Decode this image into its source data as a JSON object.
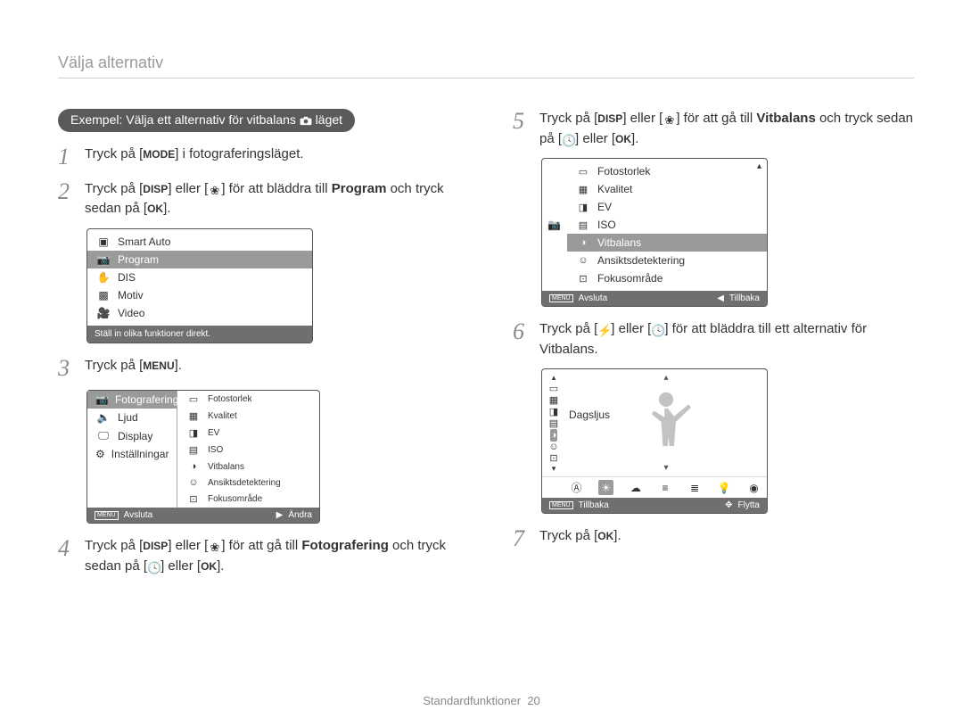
{
  "header": {
    "title": "Välja alternativ"
  },
  "pill": {
    "label_part1": "Exempel: Välja ett alternativ för vitbalans ",
    "label_part2": " läget"
  },
  "steps": {
    "s1": {
      "num": "1",
      "a": "Tryck på [",
      "b": "] i fotograferingsläget."
    },
    "s2": {
      "num": "2",
      "a": "Tryck på [",
      "b": "] eller [",
      "c": "] för att bläddra till ",
      "d": "Program",
      "e": " och tryck sedan på [",
      "f": "]."
    },
    "s3": {
      "num": "3",
      "a": "Tryck på [",
      "b": "]."
    },
    "s4": {
      "num": "4",
      "a": "Tryck på [",
      "b": "] eller [",
      "c": "] för att gå till ",
      "d": "Fotografering",
      "e": " och tryck sedan på [",
      "f": "] eller [",
      "g": "]."
    },
    "s5": {
      "num": "5",
      "a": "Tryck på [",
      "b": "] eller [",
      "c": "] för att gå till ",
      "d": "Vitbalans",
      "e": " och tryck sedan på [",
      "f": "] eller [",
      "g": "]."
    },
    "s6": {
      "num": "6",
      "a": "Tryck på [",
      "b": "] eller [",
      "c": "] för att bläddra till ett alternativ för Vitbalans."
    },
    "s7": {
      "num": "7",
      "a": "Tryck på [",
      "b": "]."
    }
  },
  "lcd1": {
    "items": [
      {
        "label": "Smart Auto"
      },
      {
        "label": "Program",
        "selected": true
      },
      {
        "label": "DIS"
      },
      {
        "label": "Motiv"
      },
      {
        "label": "Video"
      }
    ],
    "status": "Ställ in olika funktioner direkt."
  },
  "lcd2": {
    "left": [
      {
        "label": "Fotografering",
        "selected": true
      },
      {
        "label": "Ljud"
      },
      {
        "label": "Display"
      },
      {
        "label": "Inställningar"
      }
    ],
    "right": [
      "Fotostorlek",
      "Kvalitet",
      "EV",
      "ISO",
      "Vitbalans",
      "Ansiktsdetektering",
      "Fokusområde"
    ],
    "footer": {
      "exit": "Avsluta",
      "change": "Ändra"
    }
  },
  "lcd3": {
    "items": [
      {
        "label": "Fotostorlek"
      },
      {
        "label": "Kvalitet"
      },
      {
        "label": "EV"
      },
      {
        "label": "ISO"
      },
      {
        "label": "Vitbalans",
        "selected": true
      },
      {
        "label": "Ansiktsdetektering"
      },
      {
        "label": "Fokusområde"
      }
    ],
    "footer": {
      "exit": "Avsluta",
      "back": "Tillbaka"
    }
  },
  "wb": {
    "current": "Dagsljus",
    "footer": {
      "back": "Tillbaka",
      "move": "Flytta"
    }
  },
  "footer": {
    "section": "Standardfunktioner",
    "pagenum": "20"
  }
}
